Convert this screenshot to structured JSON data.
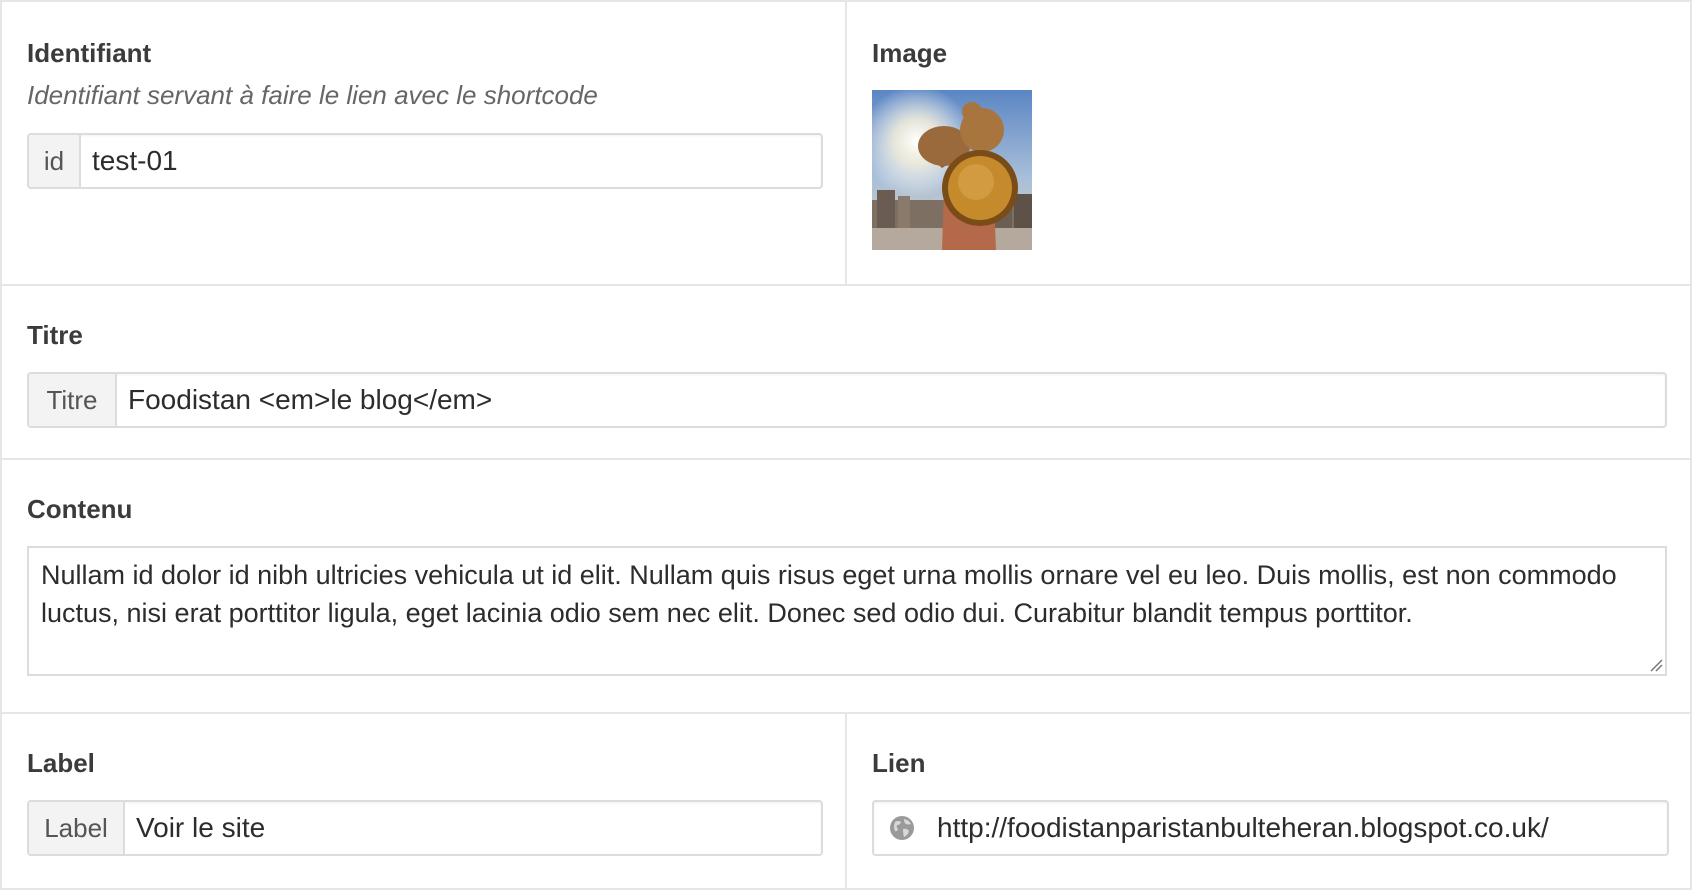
{
  "identifiant": {
    "label": "Identifiant",
    "description": "Identifiant servant à faire le lien avec le shortcode",
    "addon": "id",
    "value": "test-01"
  },
  "image": {
    "label": "Image",
    "thumbnail_alt": "Image thumbnail"
  },
  "titre": {
    "label": "Titre",
    "addon": "Titre",
    "value": "Foodistan <em>le blog</em>"
  },
  "contenu": {
    "label": "Contenu",
    "value": "Nullam id dolor id nibh ultricies vehicula ut id elit. Nullam quis risus eget urna mollis ornare vel eu leo. Duis mollis, est non commodo luctus, nisi erat porttitor ligula, eget lacinia odio sem nec elit. Donec sed odio dui. Curabitur blandit tempus porttitor."
  },
  "label_field": {
    "label": "Label",
    "addon": "Label",
    "value": "Voir le site"
  },
  "lien": {
    "label": "Lien",
    "icon": "globe-icon",
    "value": "http://foodistanparistanbulteheran.blogspot.co.uk/"
  },
  "colors": {
    "border": "#e6e6e6",
    "addon_bg": "#f3f3f3",
    "label_text": "#3b3b3b",
    "description_text": "#666666"
  }
}
